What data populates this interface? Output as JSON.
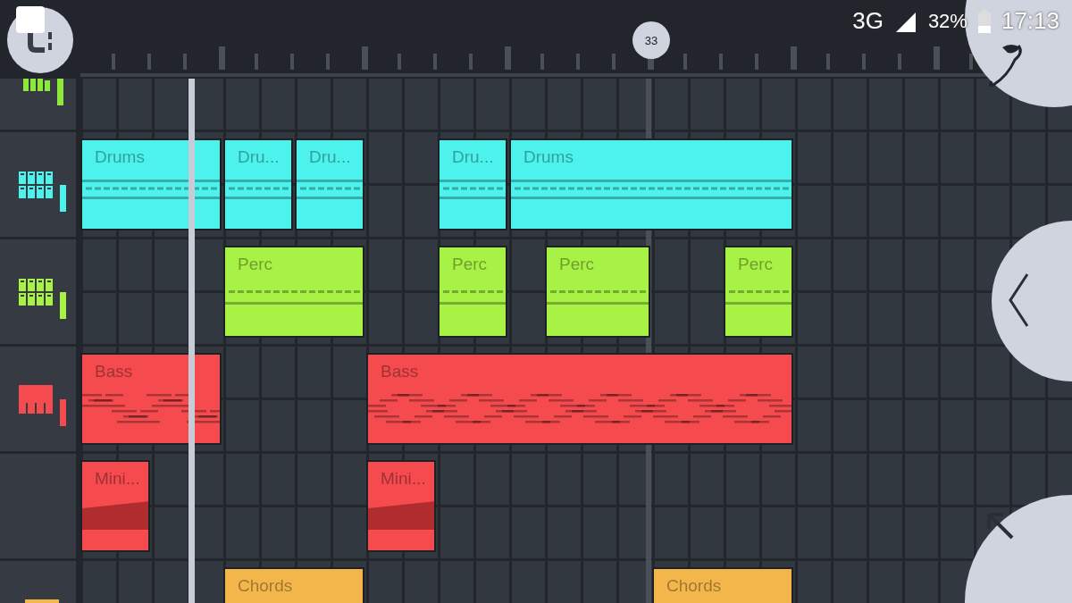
{
  "status_bar": {
    "network": "3G",
    "battery": "32%",
    "time": "17:13"
  },
  "ruler": {
    "position_marker": "33"
  },
  "tracks": [
    {
      "kind": "bars",
      "color": "#8ee83a"
    },
    {
      "kind": "steps",
      "color": "#4ef2ec",
      "clips": [
        {
          "label": "Drums",
          "kind": "pattern"
        },
        {
          "label": "Dru...",
          "kind": "pattern"
        },
        {
          "label": "Dru...",
          "kind": "pattern"
        },
        {
          "label": "Dru...",
          "kind": "pattern"
        },
        {
          "label": "Drums",
          "kind": "pattern"
        }
      ]
    },
    {
      "kind": "steps",
      "color": "#a8f246",
      "clips": [
        {
          "label": "Perc",
          "kind": "pattern"
        },
        {
          "label": "Perc",
          "kind": "pattern"
        },
        {
          "label": "Perc",
          "kind": "pattern"
        },
        {
          "label": "Perc",
          "kind": "pattern"
        }
      ]
    },
    {
      "kind": "keys",
      "color": "#f54b4e",
      "clips": [
        {
          "label": "Bass",
          "kind": "notes"
        },
        {
          "label": "Bass",
          "kind": "notes"
        }
      ]
    },
    {
      "kind": "plain",
      "color": "#f54b4e",
      "clips": [
        {
          "label": "Mini...",
          "kind": "automation"
        },
        {
          "label": "Mini...",
          "kind": "automation"
        }
      ]
    },
    {
      "kind": "keys",
      "color": "#f3b64a",
      "clips": [
        {
          "label": "Chords",
          "kind": "chords"
        },
        {
          "label": "Chords",
          "kind": "chords"
        }
      ]
    }
  ]
}
